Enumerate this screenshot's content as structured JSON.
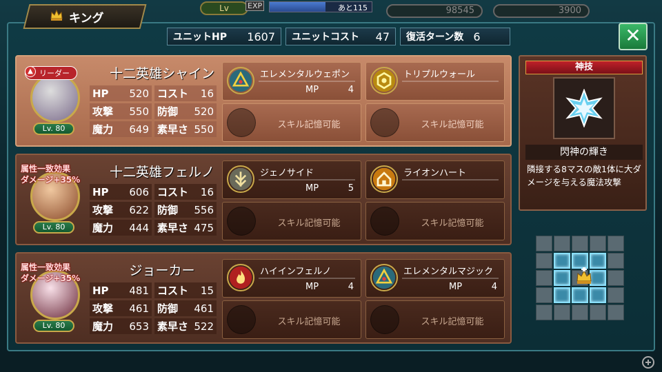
{
  "topbar": {
    "lv_label": "Lv",
    "exp_label": "EXP",
    "exp_remaining": "あと115",
    "exp_fill": 0.55,
    "currency1": "98545",
    "currency2": "3900"
  },
  "title": "キング",
  "summary": {
    "unit_hp_label": "ユニットHP",
    "unit_hp": "1607",
    "unit_cost_label": "ユニットコスト",
    "unit_cost": "47",
    "revive_label": "復活ターン数",
    "revive": "6"
  },
  "close_symbol": "✕",
  "stat_labels": {
    "hp": "HP",
    "cost": "コスト",
    "atk": "攻撃",
    "def": "防御",
    "mag": "魔力",
    "spd": "素早さ"
  },
  "units": [
    {
      "name": "十二英雄シャイン",
      "leader_tag": "リーダー",
      "level": "Lv. 80",
      "hp": "520",
      "cost": "16",
      "atk": "550",
      "def": "520",
      "mag": "649",
      "spd": "550",
      "skills": [
        {
          "name": "エレメンタルウェポン",
          "mp_label": "MP",
          "mp": "4",
          "icon": "elemental-icon"
        },
        {
          "name": "トリプルウォール",
          "mp_label": "",
          "mp": "",
          "icon": "wall-icon"
        }
      ],
      "empty_label": "スキル記憶可能"
    },
    {
      "name": "十二英雄フェルノ",
      "attr_tag_1": "属性一致効果",
      "attr_tag_2": "ダメージ+35%",
      "level": "Lv. 80",
      "hp": "606",
      "cost": "16",
      "atk": "622",
      "def": "556",
      "mag": "444",
      "spd": "475",
      "skills": [
        {
          "name": "ジェノサイド",
          "mp_label": "MP",
          "mp": "5",
          "icon": "genocide-icon"
        },
        {
          "name": "ライオンハート",
          "mp_label": "",
          "mp": "",
          "icon": "lionheart-icon"
        }
      ],
      "empty_label": "スキル記憶可能"
    },
    {
      "name": "ジョーカー",
      "attr_tag_1": "属性一致効果",
      "attr_tag_2": "ダメージ+35%",
      "level": "Lv. 80",
      "hp": "481",
      "cost": "15",
      "atk": "461",
      "def": "461",
      "mag": "653",
      "spd": "522",
      "skills": [
        {
          "name": "ハイインフェルノ",
          "mp_label": "MP",
          "mp": "4",
          "icon": "fire-icon"
        },
        {
          "name": "エレメンタルマジック",
          "mp_label": "MP",
          "mp": "4",
          "icon": "elemental-icon"
        }
      ],
      "empty_label": "スキル記憶可能"
    }
  ],
  "god_skill": {
    "header": "神技",
    "name": "閃神の輝き",
    "description": "隣接する8マスの敵1体に大ダメージを与える魔法攻撃",
    "icon": "star-burst-icon"
  },
  "range_grid": {
    "highlighted": [
      6,
      7,
      8,
      11,
      13,
      16,
      17,
      18
    ],
    "center": 12
  },
  "colors": {
    "leader_card": "#b87a5c",
    "card": "#5a3628",
    "highlight_cell": "#3a8aa8"
  }
}
